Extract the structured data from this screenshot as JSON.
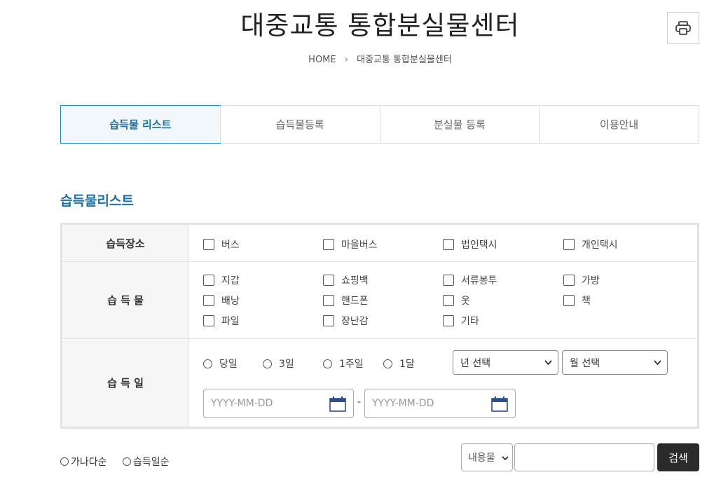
{
  "page": {
    "title": "대중교통 통합분실물센터"
  },
  "breadcrumb": {
    "home": "HOME",
    "separator": "›",
    "current": "대중교통 통합분실물센터"
  },
  "tabs": [
    {
      "label": "습득물 리스트",
      "active": true
    },
    {
      "label": "습득물등록",
      "active": false
    },
    {
      "label": "분실물 등록",
      "active": false
    },
    {
      "label": "이용안내",
      "active": false
    }
  ],
  "section": {
    "title": "습득물리스트"
  },
  "filters": {
    "place": {
      "label": "습득장소",
      "options": [
        "버스",
        "마을버스",
        "법인택시",
        "개인택시"
      ]
    },
    "item": {
      "label": "습 득 물",
      "options": [
        "지갑",
        "쇼핑백",
        "서류봉투",
        "가방",
        "배낭",
        "핸드폰",
        "옷",
        "책",
        "파일",
        "장난감",
        "기타"
      ]
    },
    "date": {
      "label": "습 득 일",
      "periods": [
        "당일",
        "3일",
        "1주일",
        "1달"
      ],
      "year_select": "년 선택",
      "month_select": "월 선택",
      "start_placeholder": "YYYY-MM-DD",
      "end_placeholder": "YYYY-MM-DD",
      "range_separator": "-"
    }
  },
  "sort": {
    "options": [
      "가나다순",
      "습득일순"
    ]
  },
  "search": {
    "field_select": "내용물",
    "input_value": "",
    "button": "검색"
  },
  "colors": {
    "accent": "#1c6fa7",
    "search_button": "#2b2b2b"
  },
  "icons": {
    "print": "print-icon",
    "calendar": "calendar-icon",
    "chevron": "chevron-down-icon"
  }
}
